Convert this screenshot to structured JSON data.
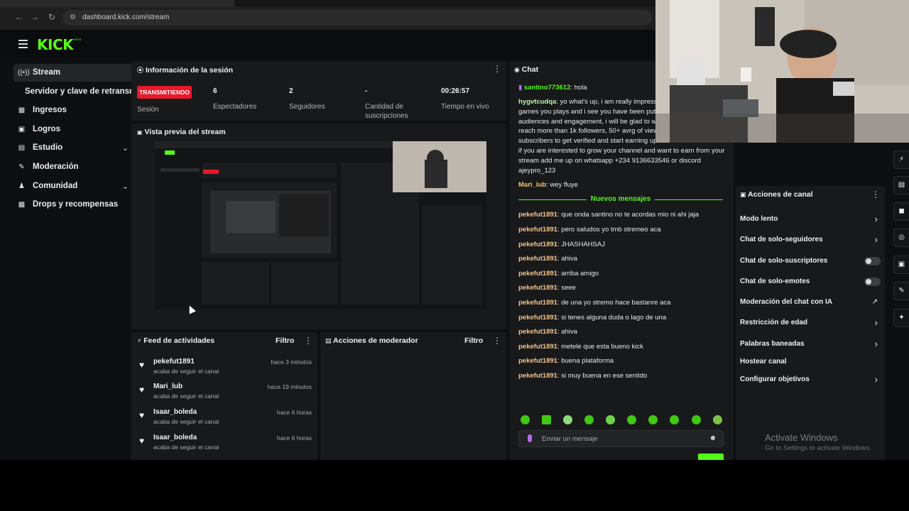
{
  "browser": {
    "url": "dashboard.kick.com/stream"
  },
  "header": {
    "logo": "KICK",
    "logo_badge": "BETA"
  },
  "sidebar": {
    "items": [
      {
        "label": "Stream",
        "icon": "broadcast-icon",
        "active": true
      },
      {
        "label": "Servidor y clave de retransm",
        "icon": "",
        "sub": true
      },
      {
        "label": "Ingresos",
        "icon": "money-icon"
      },
      {
        "label": "Logros",
        "icon": "trophy-icon"
      },
      {
        "label": "Estudio",
        "icon": "studio-icon",
        "expandable": true
      },
      {
        "label": "Moderación",
        "icon": "wrench-icon"
      },
      {
        "label": "Comunidad",
        "icon": "people-icon",
        "expandable": true
      },
      {
        "label": "Drops y recompensas",
        "icon": "gift-icon"
      }
    ]
  },
  "session": {
    "title": "Información de la sesión",
    "status_badge": "TRANSMITIENDO",
    "status_label": "Sesión",
    "stats": [
      {
        "value": "6",
        "label": "Espectadores"
      },
      {
        "value": "2",
        "label": "Seguidores"
      },
      {
        "value": "-",
        "label": "Cantidad de suscripciones"
      },
      {
        "value": "00:26:57",
        "label": "Tiempo en vivo"
      }
    ]
  },
  "preview": {
    "title": "Vista previa del stream"
  },
  "feed": {
    "title": "Feed de actividades",
    "filter_label": "Filtro",
    "items": [
      {
        "name": "pekefut1891",
        "action": "acaba de seguir el canal",
        "time": "hace 3 minutos"
      },
      {
        "name": "Mari_lub",
        "action": "acaba de seguir el canal",
        "time": "hace 19 minutos"
      },
      {
        "name": "Isaar_boleda",
        "action": "acaba de seguir el canal",
        "time": "hace 6 horas"
      },
      {
        "name": "Isaar_boleda",
        "action": "acaba de seguir el canal",
        "time": "hace 6 horas"
      }
    ]
  },
  "mod_actions": {
    "title": "Acciones de moderador",
    "filter_label": "Filtro"
  },
  "chat": {
    "title": "Chat",
    "first_user": "santino773612",
    "first_msg": "hola",
    "long_user": "hygvtcudqa",
    "long_lines": [
      ": yo what's up, i am really impresse",
      "games you plays and i see you have been puttin",
      "audiences and engagement, i will be glad to wo",
      "reach more than 1k followers, 50+ avrg of view",
      "subscribers to get verified and start earning up",
      "if you are interested to grow your channel and want to earn from your",
      "stream add me up on whatsapp +234 9136633546 or discord",
      "ajeypro_123"
    ],
    "reply_user": "Mari_lub",
    "reply_msg": "wey fluye",
    "new_messages_label": "Nuevos mensajes",
    "messages": [
      {
        "user": "pekefut1891",
        "text": "que onda santino no te acordas mio ni ahi jaja"
      },
      {
        "user": "pekefut1891",
        "text": "pero saludos yo tmb stremeo aca"
      },
      {
        "user": "pekefut1891",
        "text": "JHASHAHSAJ"
      },
      {
        "user": "pekefut1891",
        "text": "ahiva"
      },
      {
        "user": "pekefut1891",
        "text": "arriba amigo"
      },
      {
        "user": "pekefut1891",
        "text": "seee"
      },
      {
        "user": "pekefut1891",
        "text": "de una yo stremo hace bastanre aca"
      },
      {
        "user": "pekefut1891",
        "text": "si tenes alguna duda o lago de una"
      },
      {
        "user": "pekefut1891",
        "text": "ahiva"
      },
      {
        "user": "pekefut1891",
        "text": "metele que esta bueno kick"
      },
      {
        "user": "pekefut1891",
        "text": "buena plataforma"
      },
      {
        "user": "pekefut1891",
        "text": "si muy buena en ese sentido"
      }
    ],
    "input_placeholder": "Enviar un mensaje",
    "colors": {
      "accent": "#53fc18",
      "first_user": "#53fc18",
      "long_user": "#bdf7a5",
      "reply_user": "#f0c46e",
      "peke": "#f6c48c"
    }
  },
  "channel_actions": {
    "title": "Acciones de canal",
    "items": [
      {
        "label": "Modo lento",
        "control": "chevron"
      },
      {
        "label": "Chat de solo-seguidores",
        "control": "chevron"
      },
      {
        "label": "Chat de solo-suscriptores",
        "control": "toggle"
      },
      {
        "label": "Chat de solo-emotes",
        "control": "toggle"
      },
      {
        "label": "Moderación del chat con IA",
        "control": "external"
      },
      {
        "label": "Restricción de edad",
        "control": "chevron"
      },
      {
        "label": "Palabras baneadas",
        "control": "chevron"
      },
      {
        "label": "Hostear canal",
        "control": "none"
      },
      {
        "label": "Configurar objetivos",
        "control": "chevron"
      }
    ]
  },
  "windows_watermark": {
    "line1": "Activate Windows",
    "line2": "Go to Settings to activate Windows."
  }
}
